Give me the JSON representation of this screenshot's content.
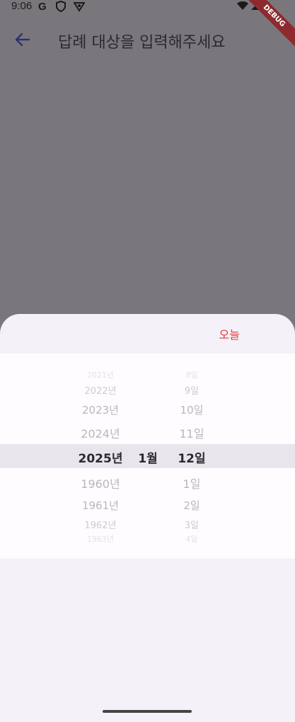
{
  "status": {
    "time": "9:06",
    "left_icons": [
      "google-icon",
      "shield-icon",
      "vpn-icon"
    ],
    "right_icons": [
      "wifi-icon",
      "signal-icon",
      "battery-icon"
    ]
  },
  "debug_label": "DEBUG",
  "appbar": {
    "title": "답례 대상을 입력해주세요"
  },
  "sheet": {
    "today_label": "오늘"
  },
  "picker": {
    "year": [
      "2021년",
      "2022년",
      "2023년",
      "2024년",
      "2025년",
      "1960년",
      "1961년",
      "1962년",
      "1963년"
    ],
    "month": [
      "1월"
    ],
    "day": [
      "8일",
      "9일",
      "10일",
      "11일",
      "12일",
      "1일",
      "2일",
      "3일",
      "4일"
    ]
  },
  "colors": {
    "accent": "#e53935",
    "scrim": "#7a777c",
    "sheet": "#f5f1f8"
  }
}
